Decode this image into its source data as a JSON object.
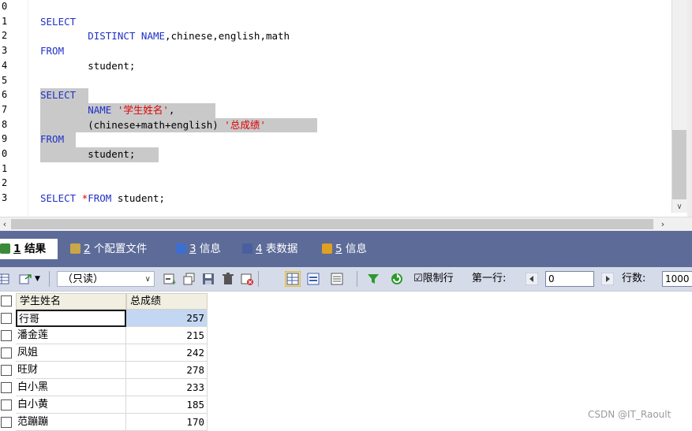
{
  "editor": {
    "line_numbers": [
      "0",
      "1",
      "2",
      "3",
      "4",
      "5",
      "6",
      "7",
      "8",
      "9",
      "0",
      "1",
      "2",
      "3"
    ],
    "lines": [
      {
        "parts": []
      },
      {
        "parts": [
          {
            "t": "SELECT",
            "c": "kw"
          }
        ]
      },
      {
        "parts": [
          {
            "t": "        DISTINCT NAME",
            "c": "kw"
          },
          {
            "t": ",chinese,english,math",
            "c": ""
          }
        ]
      },
      {
        "parts": [
          {
            "t": "FROM",
            "c": "kw"
          }
        ]
      },
      {
        "parts": [
          {
            "t": "        student;",
            "c": ""
          }
        ]
      },
      {
        "parts": []
      },
      {
        "parts": [
          {
            "t": "SELECT",
            "c": "kw"
          }
        ]
      },
      {
        "parts": [
          {
            "t": "        NAME ",
            "c": "kw"
          },
          {
            "t": "'学生姓名'",
            "c": "str"
          },
          {
            "t": ",",
            "c": ""
          }
        ]
      },
      {
        "parts": [
          {
            "t": "        (chinese+math+english) ",
            "c": ""
          },
          {
            "t": "'总成绩'",
            "c": "str"
          }
        ]
      },
      {
        "parts": [
          {
            "t": "FROM",
            "c": "kw"
          }
        ]
      },
      {
        "parts": [
          {
            "t": "        student;",
            "c": ""
          }
        ]
      },
      {
        "parts": []
      },
      {
        "parts": []
      },
      {
        "parts": [
          {
            "t": "SELECT ",
            "c": "kw"
          },
          {
            "t": "*",
            "c": "str"
          },
          {
            "t": "FROM ",
            "c": "kw"
          },
          {
            "t": "student;",
            "c": ""
          }
        ]
      }
    ]
  },
  "tabs": [
    {
      "num": "1",
      "label": " 结果",
      "icon": "result-grid-icon",
      "color": "#3a8a3a"
    },
    {
      "num": "2",
      "label": " 个配置文件",
      "icon": "profile-icon",
      "color": "#c9a64a"
    },
    {
      "num": "3",
      "label": " 信息",
      "icon": "info-icon",
      "color": "#3b6fd0"
    },
    {
      "num": "4",
      "label": " 表数据",
      "icon": "table-data-icon",
      "color": "#4a5f9e"
    },
    {
      "num": "5",
      "label": " 信息",
      "icon": "chart-info-icon",
      "color": "#e0a020"
    }
  ],
  "toolbar": {
    "readonly_label": "（只读）",
    "limit_label": "☑限制行",
    "first_row_label": "第一行:",
    "first_row_value": "0",
    "rows_label": "行数:",
    "rows_value": "1000"
  },
  "grid": {
    "columns": [
      "学生姓名",
      "总成绩"
    ],
    "rows": [
      {
        "name": "行哥",
        "score": "257"
      },
      {
        "name": "潘金莲",
        "score": "215"
      },
      {
        "name": "凤姐",
        "score": "242"
      },
      {
        "name": "旺财",
        "score": "278"
      },
      {
        "name": "白小黑",
        "score": "233"
      },
      {
        "name": "白小黄",
        "score": "185"
      },
      {
        "name": "范蹦蹦",
        "score": "170"
      }
    ]
  },
  "watermark": "CSDN @IT_Raoult",
  "colors": {
    "keyword": "#2030c8",
    "string": "#e00000",
    "tab_bar": "#5d6b99",
    "toolbar": "#d6dbe9",
    "selection": "#c9c9c9"
  }
}
